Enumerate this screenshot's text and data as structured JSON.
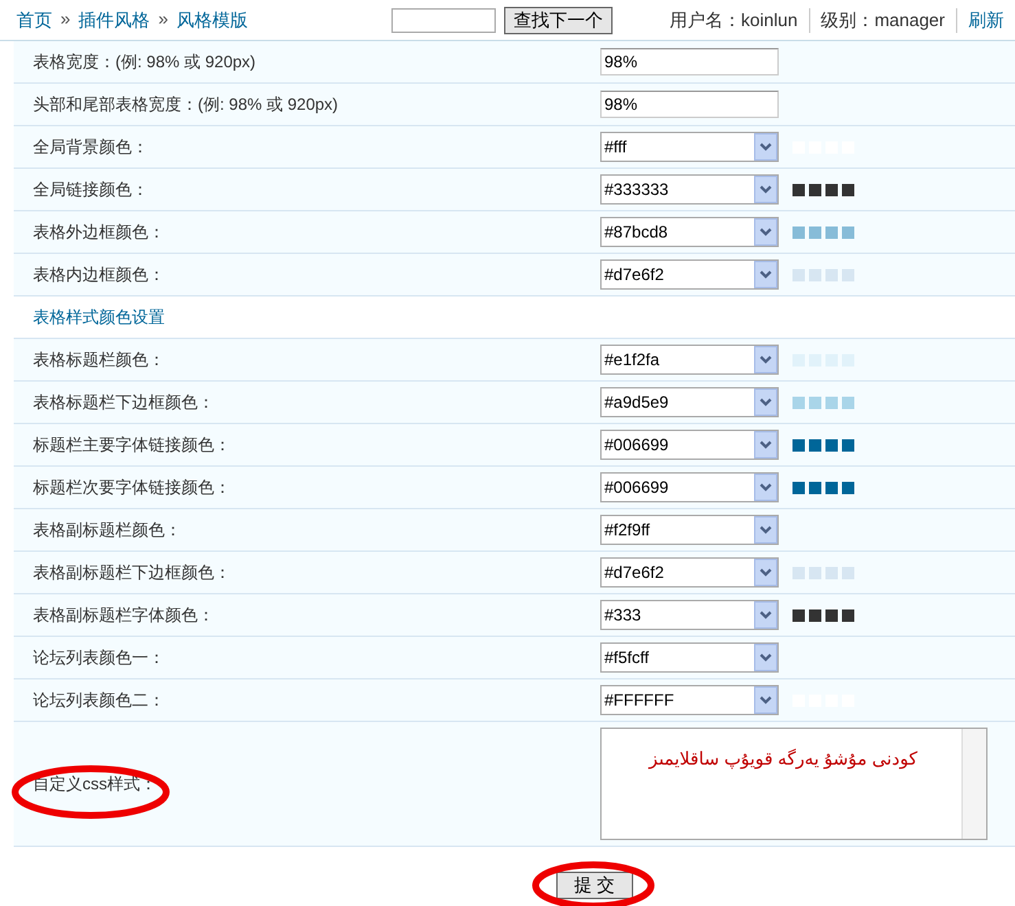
{
  "breadcrumb": [
    {
      "label": "首页"
    },
    {
      "separator": "»",
      "label": "插件风格"
    },
    {
      "separator": "»",
      "label": "风格模版"
    }
  ],
  "search": {
    "button": "查找下一个"
  },
  "user": {
    "name": "用户名：koinlun",
    "level": "级别：manager",
    "refresh": "刷新"
  },
  "settings": [
    {
      "kind": "text",
      "label": "表格宽度：(例: 98% 或 920px)",
      "value": "98%"
    },
    {
      "kind": "text",
      "label": "头部和尾部表格宽度：(例: 98% 或 920px)",
      "value": "98%"
    },
    {
      "kind": "color",
      "label": "全局背景颜色：",
      "value": "#fff",
      "color": "#ffffff"
    },
    {
      "kind": "color",
      "label": "全局链接颜色：",
      "value": "#333333",
      "color": "#333333"
    },
    {
      "kind": "color",
      "label": "表格外边框颜色：",
      "value": "#87bcd8",
      "color": "#87bcd8"
    },
    {
      "kind": "color",
      "label": "表格内边框颜色：",
      "value": "#d7e6f2",
      "color": "#d7e6f2"
    },
    {
      "kind": "section",
      "label": "表格样式颜色设置"
    },
    {
      "kind": "color",
      "label": "表格标题栏颜色：",
      "value": "#e1f2fa",
      "color": "#e1f2fa"
    },
    {
      "kind": "color",
      "label": "表格标题栏下边框颜色：",
      "value": "#a9d5e9",
      "color": "#a9d5e9"
    },
    {
      "kind": "color",
      "label": "标题栏主要字体链接颜色：",
      "value": "#006699",
      "color": "#006699"
    },
    {
      "kind": "color",
      "label": "标题栏次要字体链接颜色：",
      "value": "#006699",
      "color": "#006699"
    },
    {
      "kind": "color",
      "label": "表格副标题栏颜色：",
      "value": "#f2f9ff"
    },
    {
      "kind": "color",
      "label": "表格副标题栏下边框颜色：",
      "value": "#d7e6f2",
      "color": "#d7e6f2"
    },
    {
      "kind": "color",
      "label": "表格副标题栏字体颜色：",
      "value": "#333",
      "color": "#333333"
    },
    {
      "kind": "color",
      "label": "论坛列表颜色一：",
      "value": "#f5fcff"
    },
    {
      "kind": "color",
      "label": "论坛列表颜色二：",
      "value": "#FFFFFF",
      "color": "#ffffff"
    }
  ],
  "custom_css": {
    "label": "自定义css样式：",
    "value": "كودنى مۇشۇ يەرگە قويۇپ ساقلايمىز"
  },
  "submit": "提 交"
}
